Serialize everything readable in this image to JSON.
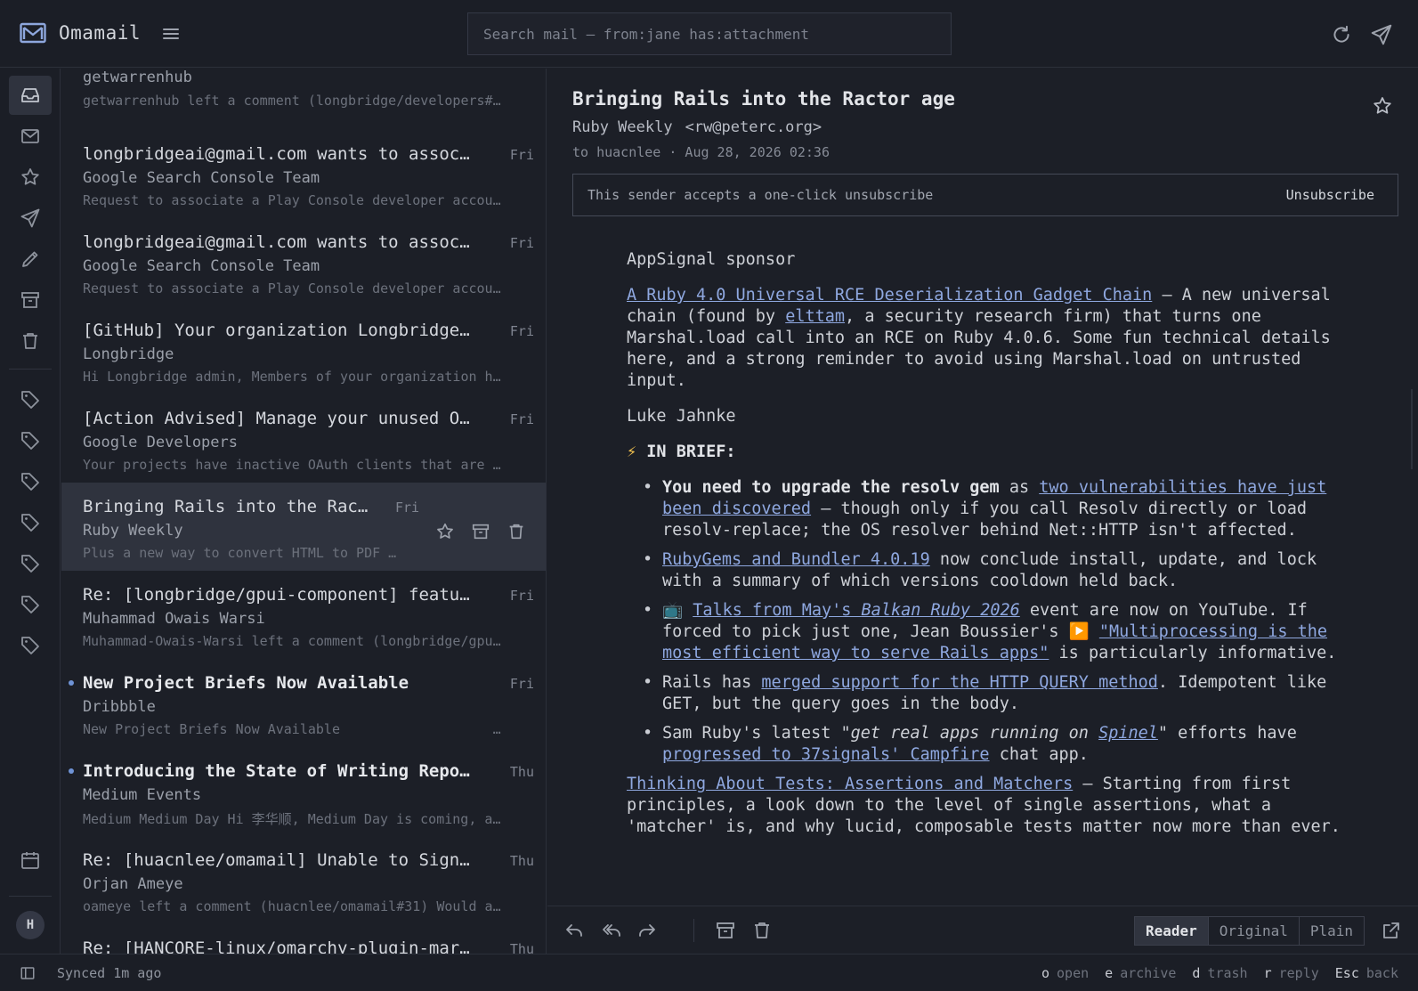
{
  "app": {
    "name": "Omamail"
  },
  "search": {
    "placeholder": "Search mail — from:jane has:attachment"
  },
  "messages": [
    {
      "subject": "",
      "from": "getwarrenhub",
      "snippet": "getwarrenhub left a comment (longbridge/developers#…",
      "date": "",
      "unread": false,
      "selected": false
    },
    {
      "subject": "longbridgeai@gmail.com wants to associa…",
      "from": "Google Search Console Team",
      "snippet": "Request to associate a Play Console developer accou…",
      "date": "Fri",
      "unread": false,
      "selected": false
    },
    {
      "subject": "longbridgeai@gmail.com wants to associa…",
      "from": "Google Search Console Team",
      "snippet": "Request to associate a Play Console developer accou…",
      "date": "Fri",
      "unread": false,
      "selected": false
    },
    {
      "subject": "[GitHub] Your organization Longbridge h…",
      "from": "Longbridge",
      "snippet": "Hi Longbridge admin, Members of your organization h…",
      "date": "Fri",
      "unread": false,
      "selected": false
    },
    {
      "subject": "[Action Advised] Manage your unused OAu…",
      "from": "Google Developers",
      "snippet": "Your projects have inactive OAuth clients that are …",
      "date": "Fri",
      "unread": false,
      "selected": false
    },
    {
      "subject": "Bringing Rails into the Ract…",
      "from": "Ruby Weekly",
      "snippet": "Plus a new way to convert HTML to PDF …",
      "date": "Fri",
      "unread": false,
      "selected": true
    },
    {
      "subject": "Re: [longbridge/gpui-component] feature…",
      "from": "Muhammad Owais Warsi",
      "snippet": "Muhammad-Owais-Warsi left a comment (longbridge/gpu…",
      "date": "Fri",
      "unread": false,
      "selected": false
    },
    {
      "subject": "New Project Briefs Now Available",
      "from": "Dribbble",
      "snippet": "New Project Briefs Now Available                   …",
      "date": "Fri",
      "unread": true,
      "selected": false
    },
    {
      "subject": "Introducing the State of Writing Report…",
      "from": "Medium Events",
      "snippet": "Medium Medium Day Hi 李华顺, Medium Day is coming, a…",
      "date": "Thu",
      "unread": true,
      "selected": false
    },
    {
      "subject": "Re: [huacnlee/omamail] Unable to Sign i…",
      "from": "Orjan Ameye",
      "snippet": "oameye left a comment (huacnlee/omamail#31) Would a…",
      "date": "Thu",
      "unread": false,
      "selected": false
    },
    {
      "subject": "Re: [HANCORE-linux/omarchy-plugin-marke…",
      "from": "",
      "snippet": "",
      "date": "Thu",
      "unread": false,
      "selected": false
    }
  ],
  "reader": {
    "subject": "Bringing Rails into the Ractor age",
    "from_name": "Ruby Weekly",
    "from_addr": "<rw@peterc.org>",
    "meta": "to huacnlee · Aug 28, 2026 02:36",
    "unsubscribe_note": "This sender accepts a one-click unsubscribe",
    "unsubscribe_label": "Unsubscribe",
    "body": {
      "sponsor": "AppSignal sponsor",
      "p1_link": "A Ruby 4.0 Universal RCE Deserialization Gadget Chain",
      "p1_a": " — A new universal chain (found by ",
      "p1_link2": "elttam",
      "p1_b": ", a security research firm) that turns one Marshal.load call into an RCE on Ruby 4.0.6. Some fun technical details here, and a strong reminder to avoid using Marshal.load on untrusted input.",
      "author": "Luke Jahnke",
      "brief_icon": "⚡",
      "brief": "IN BRIEF:",
      "b1_bold": "You need to upgrade the resolv gem",
      "b1_a": " as ",
      "b1_link": "two vulnerabilities have just been discovered",
      "b1_b": " – though only if you call Resolv directly or load resolv-replace; the OS resolver behind Net::HTTP isn't affected.",
      "b2_link": "RubyGems and Bundler 4.0.19",
      "b2_a": " now conclude install, update, and lock with a summary of which versions cooldown held back.",
      "b3_icon": "📺",
      "b3_link_a": "Talks from May's ",
      "b3_link_i": "Balkan Ruby 2026",
      "b3_a": " event are now on YouTube. If forced to pick just one, Jean Boussier's ",
      "b3_icon2": "▶️",
      "b3_link2": "\"Multiprocessing is the most efficient way to serve Rails apps\"",
      "b3_b": " is particularly informative.",
      "b4_a": "Rails has ",
      "b4_link": "merged support for the HTTP QUERY method",
      "b4_b": ". Idempotent like GET, but the query goes in the body.",
      "b5_a": "Sam Ruby's latest ",
      "b5_i": "\"get real apps running on ",
      "b5_ilink": "Spinel",
      "b5_b": "\" efforts have ",
      "b5_link": "progressed to 37signals' Campfire",
      "b5_c": " chat app.",
      "p2_link": "Thinking About Tests: Assertions and Matchers",
      "p2_a": " — Starting from first principles, a look down to the level of single assertions, what a 'matcher' is, and why lucid, composable tests matter now more than ever."
    }
  },
  "view_modes": [
    "Reader",
    "Original",
    "Plain"
  ],
  "view_active": "Reader",
  "status": {
    "sync": "Synced 1m ago"
  },
  "shortcuts": [
    {
      "key": "o",
      "label": "open"
    },
    {
      "key": "e",
      "label": "archive"
    },
    {
      "key": "d",
      "label": "trash"
    },
    {
      "key": "r",
      "label": "reply"
    },
    {
      "key": "Esc",
      "label": "back"
    }
  ],
  "colors": {
    "background": "#1c1f27",
    "selected_row": "#2f333e",
    "link": "#8fa8e0",
    "unread_dot": "#6f93d6"
  }
}
